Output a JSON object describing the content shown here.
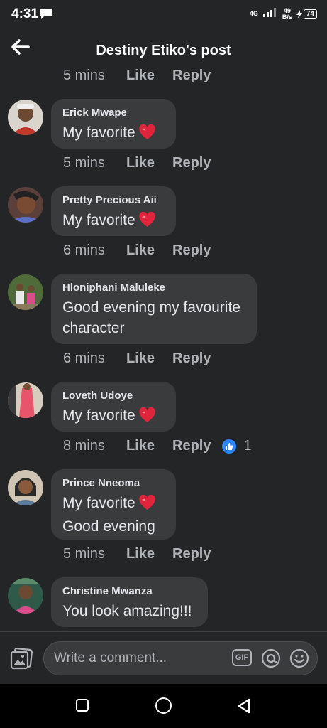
{
  "status_bar": {
    "time": "4:31",
    "network_type": "4G",
    "speed_value": "49",
    "speed_unit": "B/s",
    "battery": "74"
  },
  "header": {
    "title": "Destiny Etiko's post"
  },
  "top_meta": {
    "time": "5 mins",
    "like": "Like",
    "reply": "Reply"
  },
  "comments": [
    {
      "author": "Erick Mwape",
      "lines": [
        "My favorite"
      ],
      "heart_line": 0,
      "time": "5 mins",
      "like": "Like",
      "reply": "Reply"
    },
    {
      "author": "Pretty Precious Aii",
      "lines": [
        "My favorite"
      ],
      "heart_line": 0,
      "time": "6 mins",
      "like": "Like",
      "reply": "Reply"
    },
    {
      "author": "Hloniphani Maluleke",
      "lines": [
        "Good evening my favourite",
        "character"
      ],
      "time": "6 mins",
      "like": "Like",
      "reply": "Reply"
    },
    {
      "author": "Loveth Udoye",
      "lines": [
        "My favorite"
      ],
      "heart_line": 0,
      "time": "8 mins",
      "like": "Like",
      "reply": "Reply",
      "reaction_count": "1"
    },
    {
      "author": "Prince Nneoma",
      "lines": [
        "My favorite",
        "Good evening"
      ],
      "heart_line": 0,
      "time": "5 mins",
      "like": "Like",
      "reply": "Reply"
    },
    {
      "author": "Christine Mwanza",
      "lines": [
        "You look amazing!!!"
      ]
    }
  ],
  "composer": {
    "placeholder": "Write a comment...",
    "gif_label": "GIF"
  },
  "icons": {
    "back": "arrow-left-icon",
    "photo": "photo-icon",
    "gif": "gif-icon",
    "mention": "at-icon",
    "emoji": "smile-icon",
    "heart": "heart-emoji-icon",
    "reaction": "like-reaction-icon"
  },
  "colors": {
    "background": "#242526",
    "bubble": "#3a3b3c",
    "like_blue": "#2d88ff",
    "heart_red": "#e0243b"
  }
}
